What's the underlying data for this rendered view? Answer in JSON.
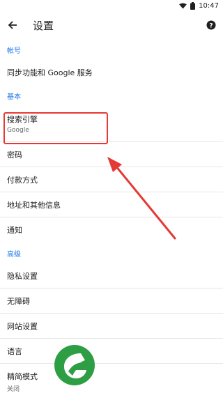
{
  "status": {
    "time": "10:47"
  },
  "header": {
    "title": "设置"
  },
  "sections": {
    "account": {
      "header": "帐号",
      "items": [
        {
          "label": "同步功能和 Google 服务"
        }
      ]
    },
    "basic": {
      "header": "基本",
      "items": [
        {
          "label": "搜索引擎",
          "subtitle": "Google"
        },
        {
          "label": "密码"
        },
        {
          "label": "付款方式"
        },
        {
          "label": "地址和其他信息"
        },
        {
          "label": "通知"
        }
      ]
    },
    "advanced": {
      "header": "高级",
      "items": [
        {
          "label": "隐私设置"
        },
        {
          "label": "无障碍"
        },
        {
          "label": "网站设置"
        },
        {
          "label": "语言"
        },
        {
          "label": "精简模式",
          "subtitle": "关闭"
        }
      ]
    }
  },
  "colors": {
    "accent": "#1a73e8",
    "annotation": "#e53935",
    "logo": "#2e9e44"
  },
  "icons": [
    "wifi-icon",
    "battery-icon",
    "back-arrow-icon",
    "help-icon"
  ]
}
